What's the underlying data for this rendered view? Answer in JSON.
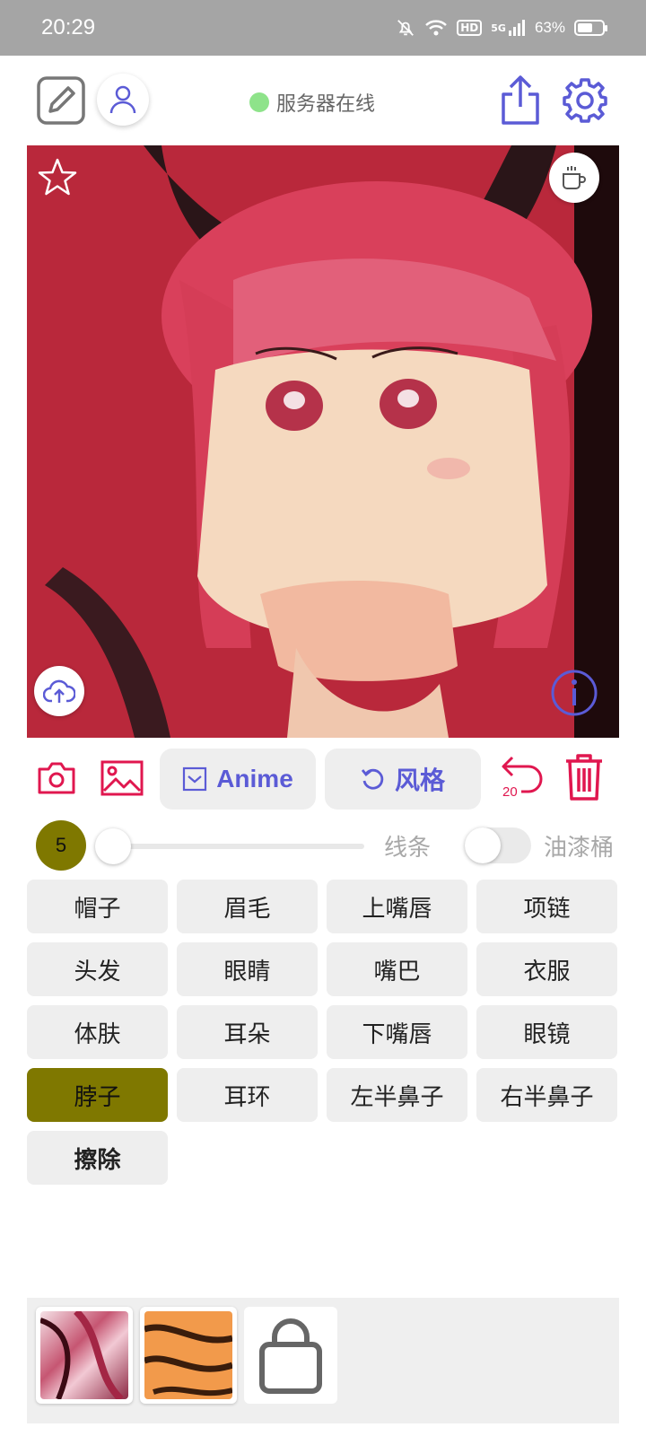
{
  "status_bar": {
    "time": "20:29",
    "network": "HD",
    "signal_type": "5G",
    "battery_percent": "63%",
    "battery_level": 0.63
  },
  "header": {
    "server_status": "服务器在线",
    "status_color": "#8ee38a",
    "accent": "#5b5bd6"
  },
  "canvas": {
    "icons": [
      "star-icon",
      "coffee-icon",
      "cloud-upload-icon",
      "info-icon"
    ]
  },
  "toolbar": {
    "anime_label": "Anime",
    "style_label": "风格",
    "undo_count": "20",
    "icon_color": "#e0174f"
  },
  "brush": {
    "size": "5",
    "slider_level": 0.0,
    "line_label": "线条",
    "bucket_label": "油漆桶",
    "bucket_on": false
  },
  "labels": [
    "帽子",
    "眉毛",
    "上嘴唇",
    "项链",
    "头发",
    "眼睛",
    "嘴巴",
    "衣服",
    "体肤",
    "耳朵",
    "下嘴唇",
    "眼镜",
    "脖子",
    "耳环",
    "左半鼻子",
    "右半鼻子",
    "擦除"
  ],
  "selected_label": "脖子",
  "selected_color": "#7f7800",
  "tray": {
    "items": [
      "style-thumbnail-1",
      "style-thumbnail-2",
      "shop-bag-icon"
    ]
  }
}
